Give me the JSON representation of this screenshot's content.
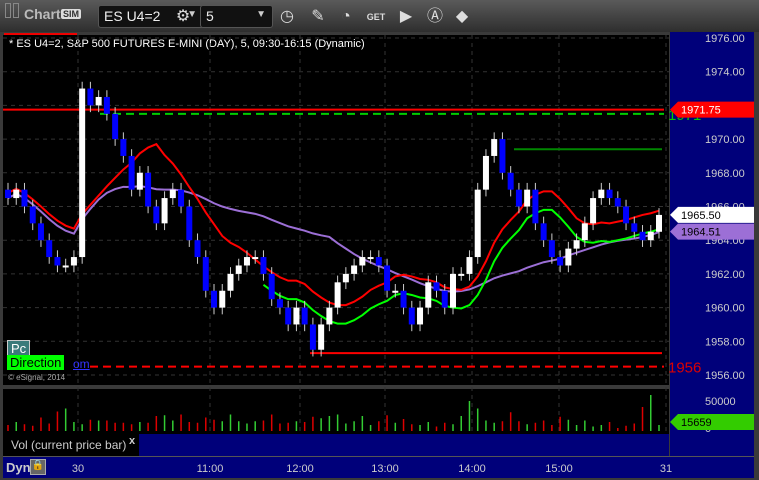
{
  "toolbar": {
    "title": "Chart",
    "sim_badge": "SIM",
    "symbol": "ES U4=2",
    "interval": "5"
  },
  "chart": {
    "title": "* ES U4=2, S&P 500 FUTURES E-MINI (DAY), 5, 09:30-16:15 (Dynamic)",
    "copyright": "© eSignal, 2014",
    "pc_label": "Pc",
    "direction_label": "Direction",
    "om_link": "om",
    "level_high": "1971",
    "level_low": "1956",
    "price_tags": {
      "red": "1971.75",
      "last": "1965.50",
      "ma": "1964.51",
      "vol": "15659"
    },
    "vol_label": "Vol (current price bar)",
    "vol_close": "x",
    "dyn_label": "Dyn",
    "colors": {
      "up": "#ffffff",
      "down": "#0000ff",
      "red": "#ff0000",
      "green": "#00ff00",
      "purple": "#9c6fd6",
      "axis": "#00007a"
    }
  },
  "chart_data": {
    "type": "candlestick",
    "yticks": [
      "1976.00",
      "1974.00",
      "1972.00",
      "1970.00",
      "1968.00",
      "1966.00",
      "1964.00",
      "1962.00",
      "1960.00",
      "1958.00",
      "1956.00"
    ],
    "ylim": [
      1955.5,
      1976.5
    ],
    "xticks": [
      "30",
      "11:00",
      "12:00",
      "13:00",
      "14:00",
      "15:00",
      "31"
    ],
    "vol_ticks": [
      "50000",
      "0"
    ],
    "closes": [
      1966.5,
      1967,
      1966,
      1965,
      1964,
      1963,
      1962.5,
      1962.5,
      1963,
      1973,
      1972,
      1972.5,
      1971.5,
      1970,
      1969,
      1967,
      1968,
      1966,
      1965,
      1966.5,
      1967,
      1966,
      1964,
      1963,
      1961,
      1960,
      1961,
      1962,
      1962.5,
      1963,
      1963,
      1962,
      1960.5,
      1960,
      1959,
      1960,
      1959,
      1957.5,
      1959,
      1960,
      1961.5,
      1962,
      1962.5,
      1963,
      1963,
      1962.5,
      1961,
      1961,
      1960,
      1959,
      1960,
      1961.5,
      1961,
      1960,
      1962,
      1962,
      1963,
      1967,
      1969,
      1970,
      1968,
      1967,
      1966,
      1967,
      1965,
      1964,
      1963,
      1962.5,
      1963.5,
      1964,
      1965,
      1966.5,
      1967,
      1966.5,
      1966,
      1965,
      1964.5,
      1964,
      1964.5,
      1965.5
    ],
    "volume": [
      8,
      12,
      9,
      7,
      18,
      10,
      26,
      30,
      12,
      9,
      15,
      14,
      14,
      11,
      11,
      9,
      12,
      11,
      20,
      21,
      14,
      22,
      12,
      11,
      18,
      15,
      13,
      22,
      13,
      10,
      13,
      14,
      22,
      10,
      11,
      13,
      12,
      19,
      17,
      20,
      22,
      10,
      13,
      20,
      8,
      13,
      21,
      11,
      16,
      9,
      8,
      12,
      6,
      11,
      9,
      20,
      40,
      30,
      14,
      11,
      13,
      25,
      13,
      9,
      11,
      14,
      8,
      19,
      15,
      8,
      14,
      6,
      8,
      12,
      4,
      7,
      10,
      32,
      48,
      8,
      13
    ],
    "levels": [
      1971.75,
      1971.5,
      1969.4,
      1957.3,
      1956.5
    ]
  }
}
